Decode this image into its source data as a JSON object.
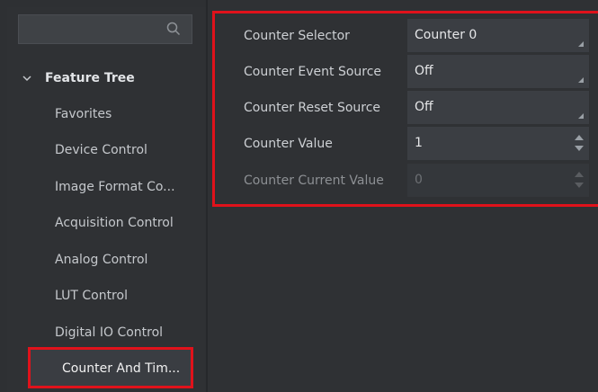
{
  "search": {
    "icon": "search-icon",
    "value": ""
  },
  "tree": {
    "root_label": "Feature Tree",
    "items": [
      {
        "label": "Favorites"
      },
      {
        "label": "Device Control"
      },
      {
        "label": "Image Format Co..."
      },
      {
        "label": "Acquisition Control"
      },
      {
        "label": "Analog Control"
      },
      {
        "label": "LUT Control"
      },
      {
        "label": "Digital IO Control"
      },
      {
        "label": "Counter And Tim...",
        "selected": true
      }
    ]
  },
  "properties": [
    {
      "label": "Counter Selector",
      "value": "Counter 0",
      "control": "combo"
    },
    {
      "label": "Counter Event Source",
      "value": "Off",
      "control": "combo"
    },
    {
      "label": "Counter Reset Source",
      "value": "Off",
      "control": "combo"
    },
    {
      "label": "Counter Value",
      "value": "1",
      "control": "spin"
    },
    {
      "label": "Counter Current Value",
      "value": "0",
      "control": "spin",
      "disabled": true
    }
  ],
  "colors": {
    "highlight_border": "#e0121b",
    "panel_bg": "#2f3134",
    "field_bg": "#3b3e43"
  }
}
